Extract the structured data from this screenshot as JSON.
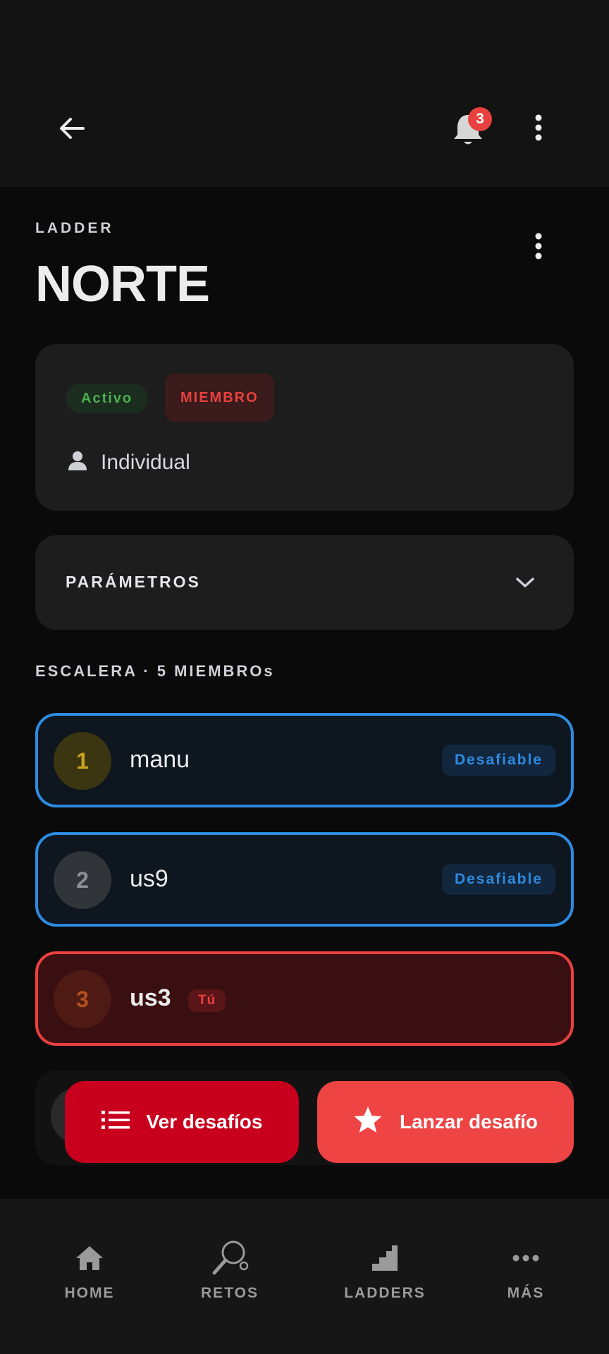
{
  "header": {
    "notification_count": "3"
  },
  "eyebrow": "LADDER",
  "title": "NORTE",
  "info": {
    "status_badge": "Activo",
    "role_badge": "MIEMBRO",
    "mode": "Individual"
  },
  "params": {
    "label": "PARÁMETROS"
  },
  "ladder": {
    "section_label": "ESCALERA · 5 MIEMBROs",
    "rows": [
      {
        "position": "1",
        "name": "manu",
        "tag": "Desafiable"
      },
      {
        "position": "2",
        "name": "us9",
        "tag": "Desafiable"
      },
      {
        "position": "3",
        "name": "us3",
        "tag": "Tú"
      }
    ]
  },
  "actions": {
    "view_label": "Ver desafíos",
    "launch_label": "Lanzar desafío"
  },
  "nav": {
    "items": [
      {
        "label": "HOME",
        "icon": "home-icon"
      },
      {
        "label": "RETOS",
        "icon": "paddle-icon"
      },
      {
        "label": "LADDERS",
        "icon": "stairs-icon"
      },
      {
        "label": "MÁS",
        "icon": "more-dots-icon"
      }
    ]
  },
  "colors": {
    "accent_red": "#e8413f",
    "accent_blue": "#2d8be0",
    "active_green": "#4caf50"
  }
}
